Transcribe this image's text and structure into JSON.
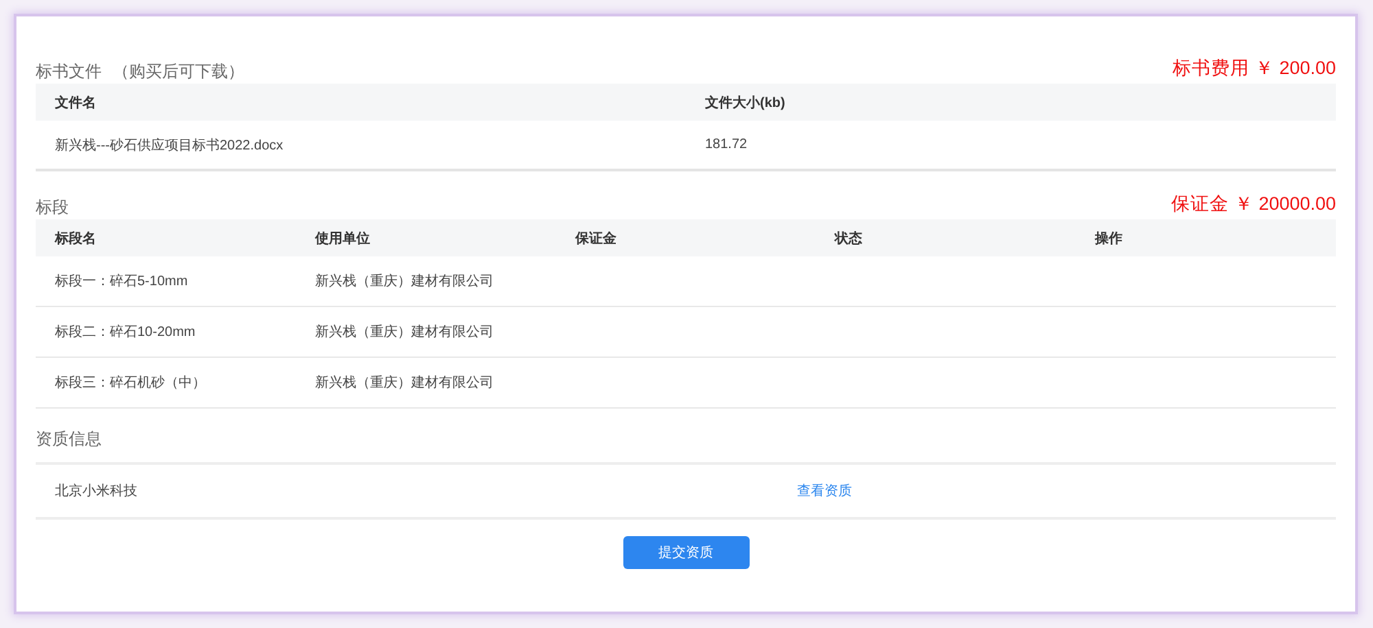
{
  "file_section": {
    "title": "标书文件",
    "note": "（购买后可下载）",
    "fee": "标书费用 ￥ 200.00",
    "columns": [
      "文件名",
      "文件大小(kb)"
    ],
    "rows": [
      [
        "新兴栈---砂石供应项目标书2022.docx",
        "181.72"
      ]
    ]
  },
  "lot_section": {
    "title": "标段",
    "deposit": "保证金 ￥ 20000.00",
    "columns": [
      "标段名",
      "使用单位",
      "保证金",
      "状态",
      "操作"
    ],
    "rows": [
      [
        "标段一：碎石5-10mm",
        "新兴栈（重庆）建材有限公司"
      ],
      [
        "标段二：碎石10-20mm",
        "新兴栈（重庆）建材有限公司"
      ],
      [
        "标段三：碎石机砂（中）",
        "新兴栈（重庆）建材有限公司"
      ]
    ]
  },
  "qualification_section": {
    "title": "资质信息",
    "company": "北京小米科技",
    "link": "查看资质"
  },
  "submit_button": "提交资质"
}
